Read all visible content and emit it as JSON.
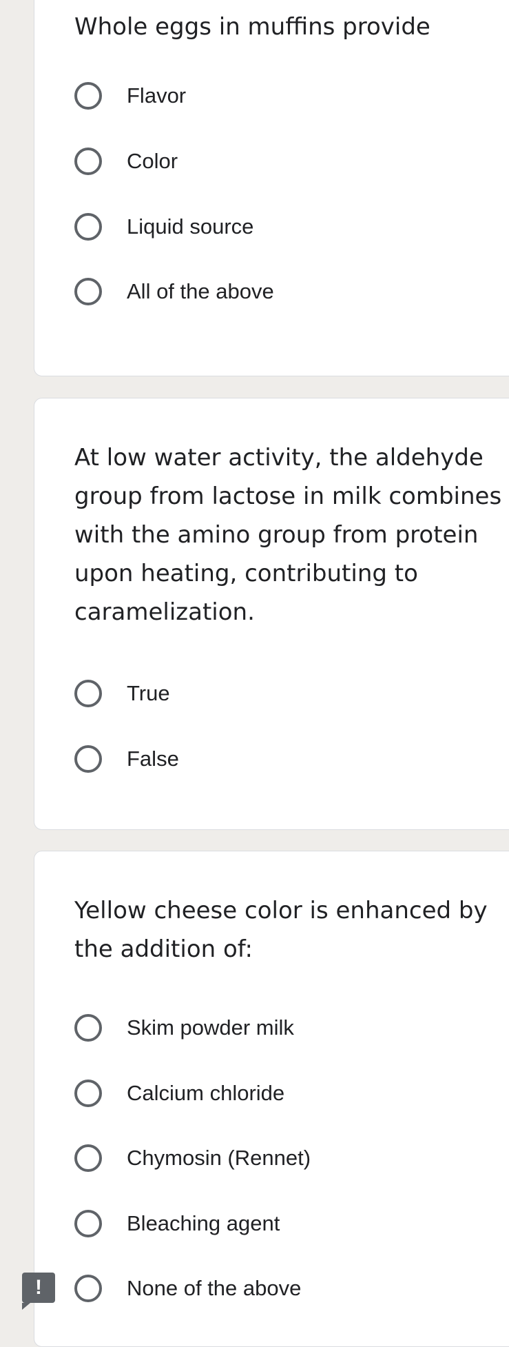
{
  "questions": [
    {
      "title": "Whole eggs in muffins provide",
      "options": [
        "Flavor",
        "Color",
        "Liquid source",
        "All of the above"
      ]
    },
    {
      "title": "At low water activity, the aldehyde group from lactose in milk combines with the amino group from protein upon heating, contributing to caramelization.",
      "options": [
        "True",
        "False"
      ]
    },
    {
      "title": "Yellow cheese color is enhanced by the addition of:",
      "options": [
        "Skim powder milk",
        "Calcium chloride",
        "Chymosin (Rennet)",
        "Bleaching agent",
        "None of the above"
      ]
    }
  ],
  "report_button": {
    "icon": "report-problem-icon",
    "glyph": "!"
  },
  "colors": {
    "page_background": "#efedea",
    "card_background": "#ffffff",
    "radio_border": "#5f6368",
    "text": "#202124"
  }
}
